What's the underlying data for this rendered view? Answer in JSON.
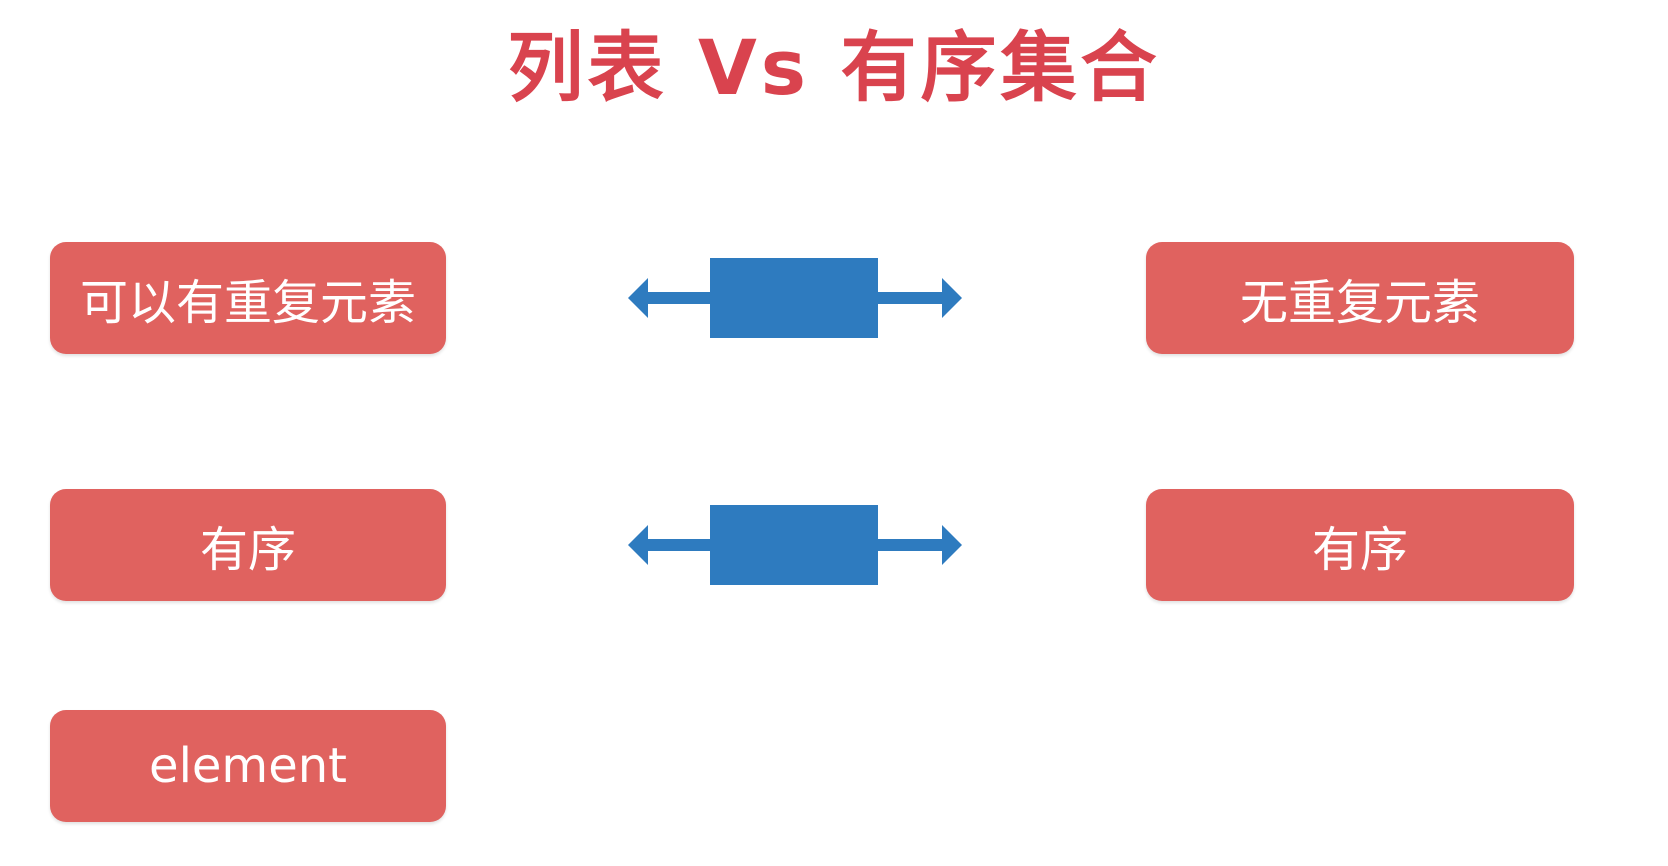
{
  "title": "列表 Vs 有序集合",
  "rows": [
    {
      "left": "可以有重复元素",
      "right": "无重复元素"
    },
    {
      "left": "有序",
      "right": "有序"
    },
    {
      "left": "element",
      "right": ""
    }
  ],
  "colors": {
    "title": "#d9434e",
    "box_fill": "#e0625f",
    "box_text": "#ffffff",
    "connector": "#2e7bbf"
  },
  "icons": {
    "connector": "double-headed-arrow-with-block"
  }
}
